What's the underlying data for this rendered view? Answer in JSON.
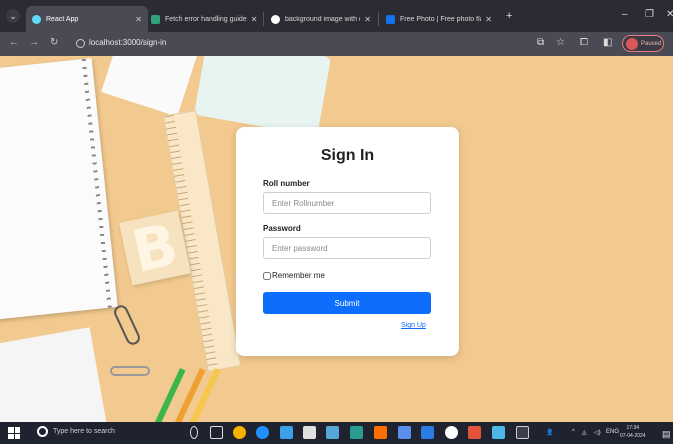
{
  "browser": {
    "tabs": [
      {
        "title": "React App",
        "active": true,
        "icon": "react-icon",
        "color": "#61dafb"
      },
      {
        "title": "Fetch error handling guide",
        "active": false,
        "icon": "doc-icon",
        "color": "#2ea37a"
      },
      {
        "title": "background image with colorfu",
        "active": false,
        "icon": "globe-icon",
        "color": "#ffffff"
      },
      {
        "title": "Free Photo | Free photo flat lay",
        "active": false,
        "icon": "freepik-icon",
        "color": "#1273eb"
      }
    ],
    "url": "localhost:3000/sign-in",
    "profile_status": "Paused"
  },
  "form": {
    "title": "Sign In",
    "roll_label": "Roll number",
    "roll_placeholder": "Enter Rollnumber",
    "password_label": "Password",
    "password_placeholder": "Enter password",
    "remember_label": "Remember me",
    "submit_label": "Submit",
    "signup_link": "Sign Up",
    "accent": "#0d6efd"
  },
  "taskbar": {
    "search_placeholder": "Type here to search",
    "language": "ENG",
    "time": "17:34",
    "date": "07-04-2024"
  }
}
